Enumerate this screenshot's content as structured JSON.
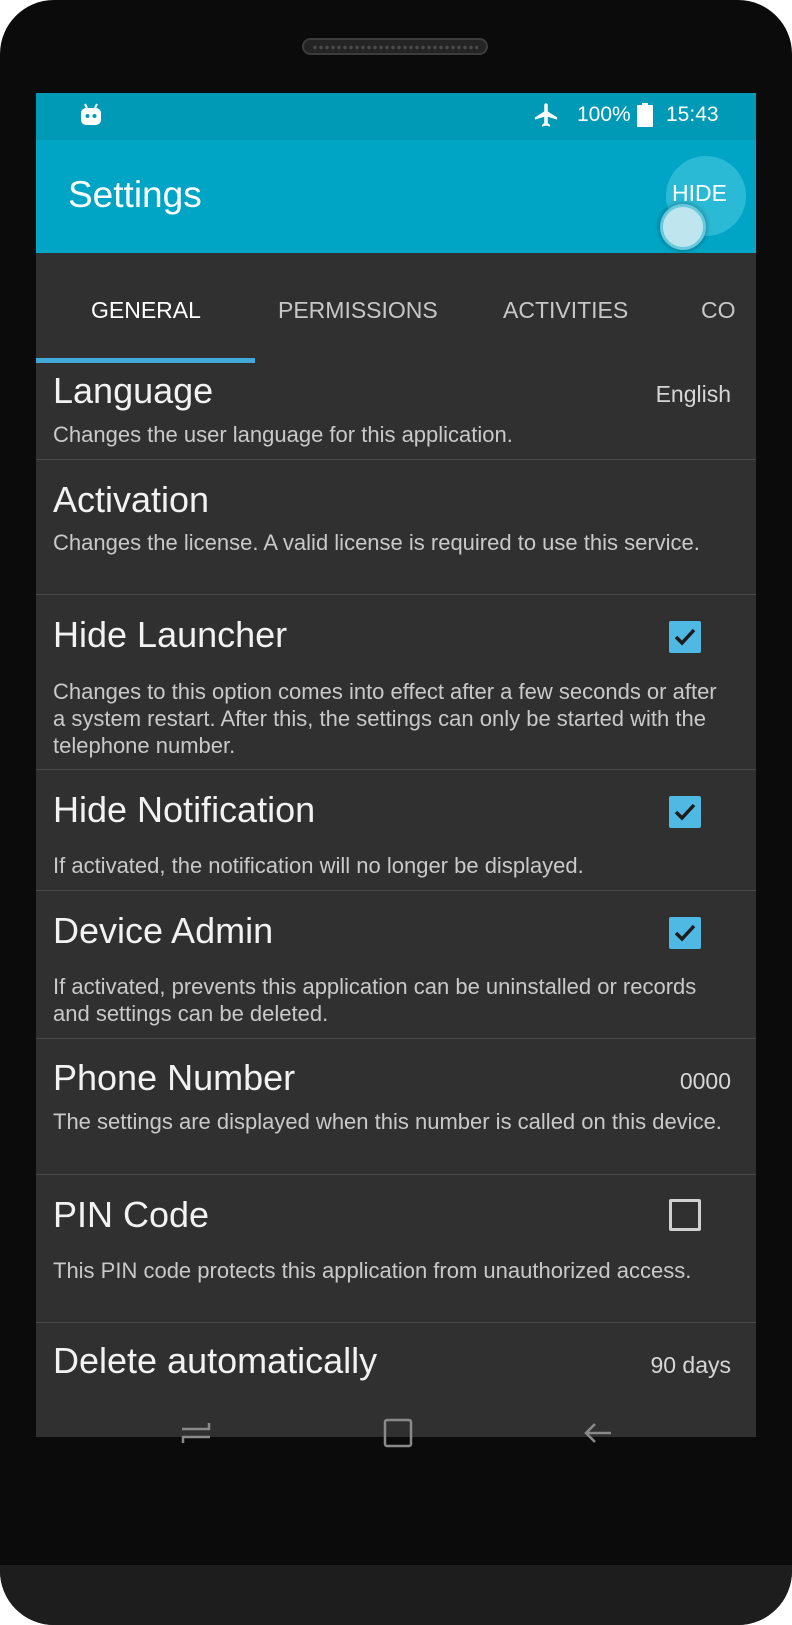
{
  "status_bar": {
    "battery_percent": "100%",
    "time": "15:43",
    "icons": [
      "android-robot-icon",
      "airplane-mode-icon",
      "battery-icon"
    ]
  },
  "app_bar": {
    "title": "Settings",
    "hide_button": "HIDE"
  },
  "tabs": [
    {
      "label": "GENERAL",
      "active": true
    },
    {
      "label": "PERMISSIONS",
      "active": false
    },
    {
      "label": "ACTIVITIES",
      "active": false
    },
    {
      "label": "CO",
      "active": false
    }
  ],
  "settings": [
    {
      "title": "Language",
      "value": "English",
      "description": "Changes the user language for this application."
    },
    {
      "title": "Activation",
      "description": "Changes the license. A valid license is required to use this service."
    },
    {
      "title": "Hide Launcher",
      "checked": true,
      "description": "Changes to this option comes into effect after a few seconds or after a system restart. After this, the settings can only be started with the telephone number."
    },
    {
      "title": "Hide Notification",
      "checked": true,
      "description": "If activated, the notification will no longer be displayed."
    },
    {
      "title": "Device Admin",
      "checked": true,
      "description": "If activated, prevents this application can be uninstalled or records and settings can be deleted."
    },
    {
      "title": "Phone Number",
      "value": "0000",
      "description": "The settings are displayed when this number is called on this device."
    },
    {
      "title": "PIN Code",
      "checked": false,
      "description": "This PIN code protects this application from unauthorized access."
    },
    {
      "title": "Delete automatically",
      "value": "90 days"
    }
  ],
  "nav_bar": {
    "icons": [
      "recent-apps-icon",
      "home-icon",
      "back-icon"
    ]
  },
  "colors": {
    "status_bar": "#0099b6",
    "app_bar": "#00a5c6",
    "background": "#303030",
    "tab_indicator": "#41a9d8",
    "checkbox": "#4fb8e3"
  }
}
